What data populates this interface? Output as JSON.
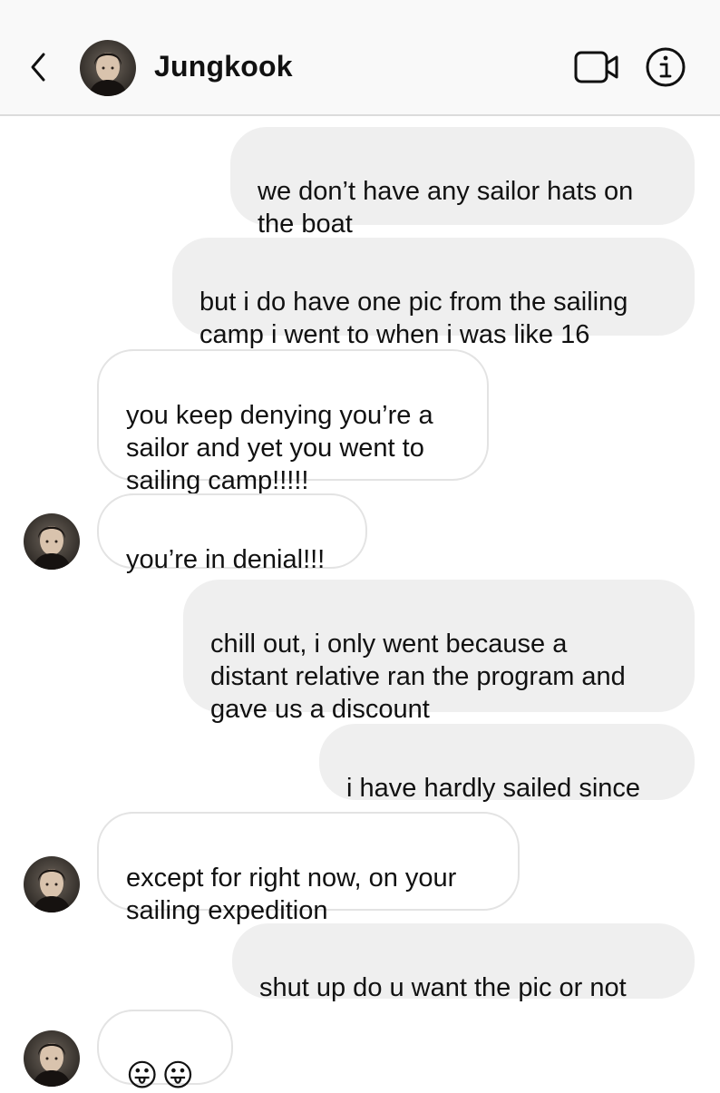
{
  "header": {
    "contact_name": "Jungkook",
    "back_icon": "chevron-left-icon",
    "video_icon": "video-camera-icon",
    "info_icon": "info-icon"
  },
  "colors": {
    "sent_bubble": "#efefef",
    "received_bubble_border": "#e3e3e3",
    "header_bg": "#f9f9f9"
  },
  "messages": [
    {
      "from": "me",
      "text": "we don’t have any sailor hats on\nthe boat"
    },
    {
      "from": "me",
      "text": "but i do have one pic from the sailing\ncamp i went to when i was like 16"
    },
    {
      "from": "them",
      "text": "you keep denying you’re a\nsailor and yet you went to\nsailing camp!!!!!"
    },
    {
      "from": "them",
      "text": "you’re in denial!!!"
    },
    {
      "from": "me",
      "text": "chill out, i only went because a\ndistant relative ran the program and\ngave us a discount"
    },
    {
      "from": "me",
      "text": "i have hardly sailed since"
    },
    {
      "from": "them",
      "text": "except for right now, on your\nsailing expedition"
    },
    {
      "from": "me",
      "text": "shut up do u want the pic or not"
    },
    {
      "from": "them",
      "text": "😛😛"
    }
  ]
}
